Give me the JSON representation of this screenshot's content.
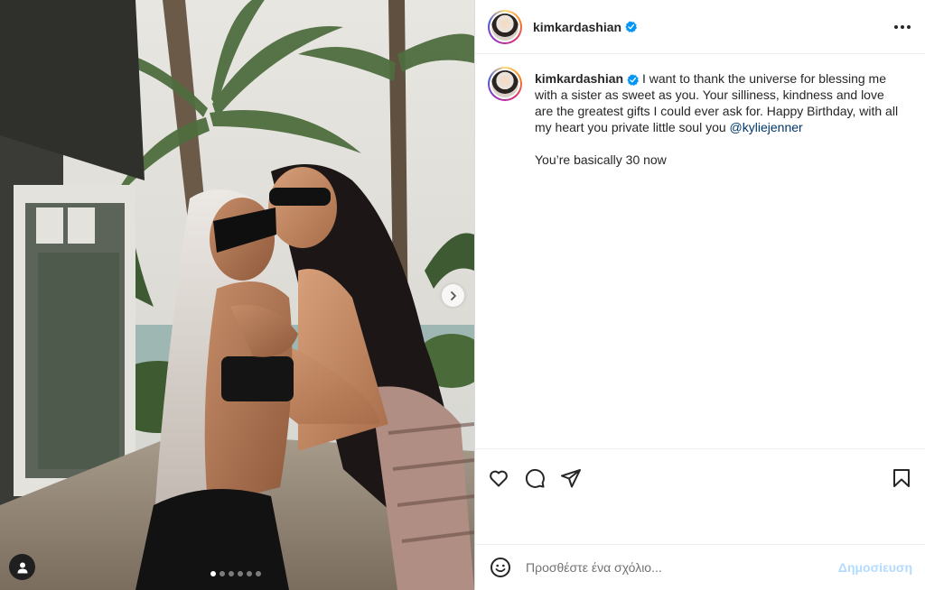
{
  "post": {
    "author": {
      "username": "kimkardashian",
      "verified": true
    },
    "media": {
      "slide_count": 6,
      "active_slide": 1,
      "next_icon": "chevron-right-icon",
      "tag_icon": "user-tag-icon"
    },
    "caption": {
      "text": "I want to thank the universe for blessing me with a sister as sweet as you. Your silliness, kindness and love are the greatest gifts I could ever ask for. Happy Birthday, with all my heart you private little soul you",
      "mention": "@kyliejenner",
      "line2": "You’re basically 30 now"
    },
    "actions": {
      "like_icon": "heart-icon",
      "comment_icon": "comment-icon",
      "share_icon": "send-icon",
      "save_icon": "bookmark-icon",
      "more_icon": "more-options-icon"
    },
    "comment_box": {
      "placeholder": "Προσθέστε ένα σχόλιο...",
      "post_label": "Δημοσίευση",
      "emoji_icon": "emoji-icon"
    },
    "colors": {
      "verified": "#0095f6",
      "mention": "#00376b",
      "post_disabled": "#b3dbff"
    }
  }
}
